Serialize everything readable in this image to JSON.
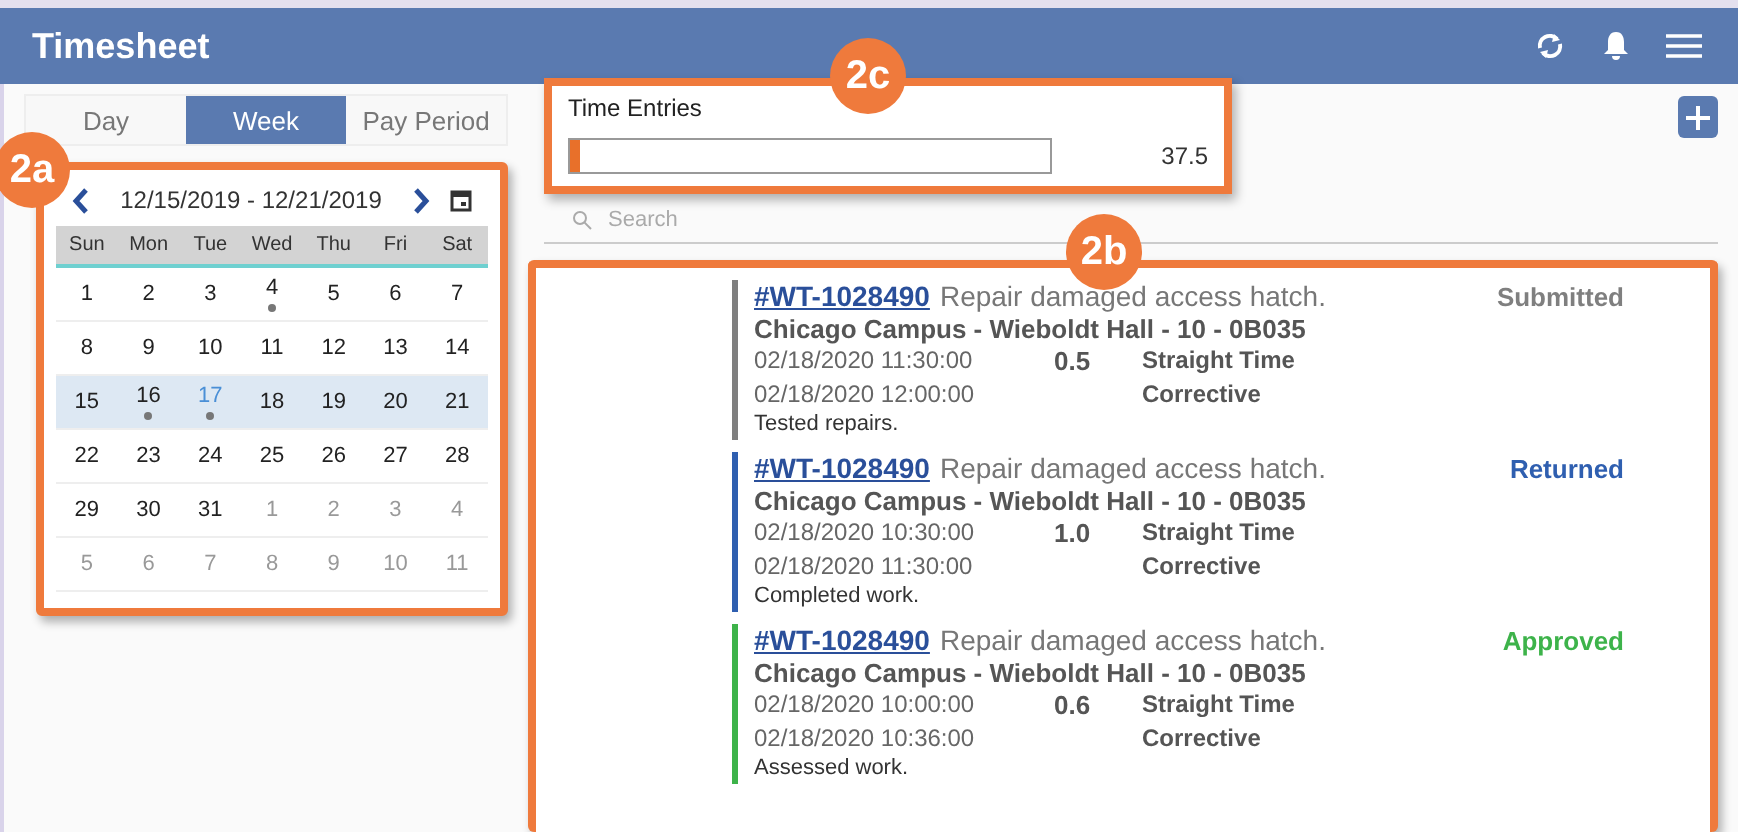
{
  "header": {
    "title": "Timesheet"
  },
  "tabs": [
    {
      "label": "Day",
      "selected": false
    },
    {
      "label": "Week",
      "selected": true
    },
    {
      "label": "Pay Period",
      "selected": false
    }
  ],
  "calendar": {
    "range": "12/15/2019 - 12/21/2019",
    "weekdays": [
      "Sun",
      "Mon",
      "Tue",
      "Wed",
      "Thu",
      "Fri",
      "Sat"
    ],
    "weeks": [
      {
        "selected": false,
        "days": [
          {
            "label": "1",
            "other_month": false,
            "dot": false,
            "today": false
          },
          {
            "label": "2",
            "other_month": false,
            "dot": false,
            "today": false
          },
          {
            "label": "3",
            "other_month": false,
            "dot": false,
            "today": false
          },
          {
            "label": "4",
            "other_month": false,
            "dot": true,
            "today": false
          },
          {
            "label": "5",
            "other_month": false,
            "dot": false,
            "today": false
          },
          {
            "label": "6",
            "other_month": false,
            "dot": false,
            "today": false
          },
          {
            "label": "7",
            "other_month": false,
            "dot": false,
            "today": false
          }
        ]
      },
      {
        "selected": false,
        "days": [
          {
            "label": "8",
            "other_month": false,
            "dot": false,
            "today": false
          },
          {
            "label": "9",
            "other_month": false,
            "dot": false,
            "today": false
          },
          {
            "label": "10",
            "other_month": false,
            "dot": false,
            "today": false
          },
          {
            "label": "11",
            "other_month": false,
            "dot": false,
            "today": false
          },
          {
            "label": "12",
            "other_month": false,
            "dot": false,
            "today": false
          },
          {
            "label": "13",
            "other_month": false,
            "dot": false,
            "today": false
          },
          {
            "label": "14",
            "other_month": false,
            "dot": false,
            "today": false
          }
        ]
      },
      {
        "selected": true,
        "days": [
          {
            "label": "15",
            "other_month": false,
            "dot": false,
            "today": false
          },
          {
            "label": "16",
            "other_month": false,
            "dot": true,
            "today": false
          },
          {
            "label": "17",
            "other_month": false,
            "dot": true,
            "today": true
          },
          {
            "label": "18",
            "other_month": false,
            "dot": false,
            "today": false
          },
          {
            "label": "19",
            "other_month": false,
            "dot": false,
            "today": false
          },
          {
            "label": "20",
            "other_month": false,
            "dot": false,
            "today": false
          },
          {
            "label": "21",
            "other_month": false,
            "dot": false,
            "today": false
          }
        ]
      },
      {
        "selected": false,
        "days": [
          {
            "label": "22",
            "other_month": false,
            "dot": false,
            "today": false
          },
          {
            "label": "23",
            "other_month": false,
            "dot": false,
            "today": false
          },
          {
            "label": "24",
            "other_month": false,
            "dot": false,
            "today": false
          },
          {
            "label": "25",
            "other_month": false,
            "dot": false,
            "today": false
          },
          {
            "label": "26",
            "other_month": false,
            "dot": false,
            "today": false
          },
          {
            "label": "27",
            "other_month": false,
            "dot": false,
            "today": false
          },
          {
            "label": "28",
            "other_month": false,
            "dot": false,
            "today": false
          }
        ]
      },
      {
        "selected": false,
        "days": [
          {
            "label": "29",
            "other_month": false,
            "dot": false,
            "today": false
          },
          {
            "label": "30",
            "other_month": false,
            "dot": false,
            "today": false
          },
          {
            "label": "31",
            "other_month": false,
            "dot": false,
            "today": false
          },
          {
            "label": "1",
            "other_month": true,
            "dot": false,
            "today": false
          },
          {
            "label": "2",
            "other_month": true,
            "dot": false,
            "today": false
          },
          {
            "label": "3",
            "other_month": true,
            "dot": false,
            "today": false
          },
          {
            "label": "4",
            "other_month": true,
            "dot": false,
            "today": false
          }
        ]
      },
      {
        "selected": false,
        "days": [
          {
            "label": "5",
            "other_month": true,
            "dot": false,
            "today": false
          },
          {
            "label": "6",
            "other_month": true,
            "dot": false,
            "today": false
          },
          {
            "label": "7",
            "other_month": true,
            "dot": false,
            "today": false
          },
          {
            "label": "8",
            "other_month": true,
            "dot": false,
            "today": false
          },
          {
            "label": "9",
            "other_month": true,
            "dot": false,
            "today": false
          },
          {
            "label": "10",
            "other_month": true,
            "dot": false,
            "today": false
          },
          {
            "label": "11",
            "other_month": true,
            "dot": false,
            "today": false
          }
        ]
      }
    ]
  },
  "time_entries": {
    "title": "Time Entries",
    "level": 0.02,
    "total": "37.5"
  },
  "search": {
    "placeholder": "Search"
  },
  "callouts": [
    "2a",
    "2b",
    "2c"
  ],
  "entries": [
    {
      "work_order": "#WT-1028490",
      "description": "Repair damaged access hatch.",
      "status": "Submitted",
      "color": "#7f7f7f",
      "location": "Chicago Campus - Wieboldt Hall - 10 - 0B035",
      "start": "02/18/2020 11:30:00",
      "end": "02/18/2020 12:00:00",
      "hours": "0.5",
      "time_type": "Straight Time",
      "category": "Corrective",
      "note": "Tested repairs."
    },
    {
      "work_order": "#WT-1028490",
      "description": "Repair damaged access hatch.",
      "status": "Returned",
      "color": "#2f5fb0",
      "location": "Chicago Campus - Wieboldt Hall - 10 - 0B035",
      "start": "02/18/2020 10:30:00",
      "end": "02/18/2020 11:30:00",
      "hours": "1.0",
      "time_type": "Straight Time",
      "category": "Corrective",
      "note": "Completed work."
    },
    {
      "work_order": "#WT-1028490",
      "description": "Repair damaged access hatch.",
      "status": "Approved",
      "color": "#3db34a",
      "location": "Chicago Campus - Wieboldt Hall - 10 - 0B035",
      "start": "02/18/2020 10:00:00",
      "end": "02/18/2020 10:36:00",
      "hours": "0.6",
      "time_type": "Straight Time",
      "category": "Corrective",
      "note": "Assessed work."
    }
  ]
}
